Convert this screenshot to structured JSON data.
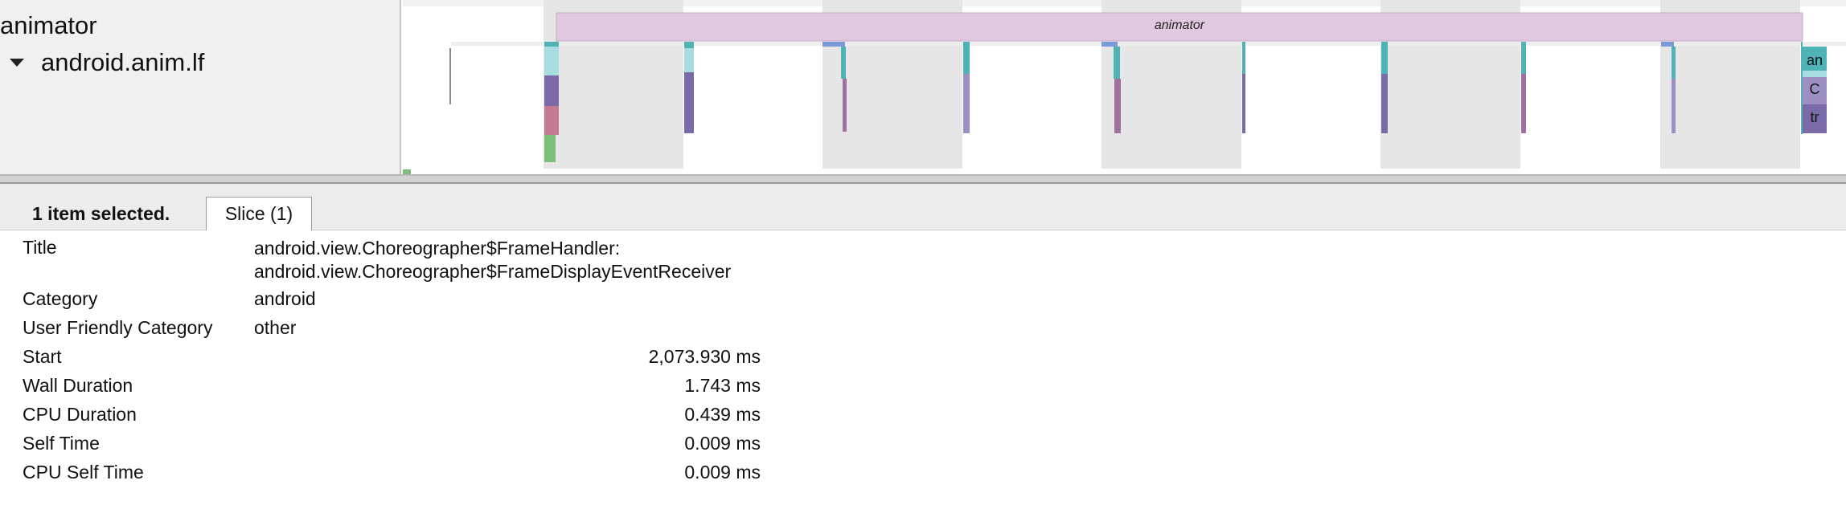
{
  "tracks": {
    "process_title": "animator",
    "thread_title": "android.anim.lf",
    "slice_top_label": "animator",
    "edge_labels": [
      "an",
      "C",
      "tr"
    ]
  },
  "colors": {
    "animator_slice": "#e0c8e0",
    "animator_slice_border": "#c8a8c8",
    "selected_column": "#e6e6e6",
    "teal": "#4fb3b5",
    "light_teal": "#a7dce0",
    "purple": "#7a6aa8",
    "light_purple": "#9d8fc4",
    "red": "#c47a90",
    "green": "#7bbf7b",
    "blue": "#7a9bd8"
  },
  "analysis": {
    "selection_summary": "1 item selected.",
    "tab_label": "Slice (1)",
    "details": [
      {
        "label": "Title",
        "value_lines": [
          "android.view.Choreographer$FrameHandler:",
          "android.view.Choreographer$FrameDisplayEventReceiver"
        ]
      },
      {
        "label": "Category",
        "value": "android"
      },
      {
        "label": "User Friendly Category",
        "value": "other"
      },
      {
        "label": "Start",
        "value": "2,073.930 ms"
      },
      {
        "label": "Wall Duration",
        "value": "1.743 ms"
      },
      {
        "label": "CPU Duration",
        "value": "0.439 ms"
      },
      {
        "label": "Self Time",
        "value": "0.009 ms"
      },
      {
        "label": "CPU Self Time",
        "value": "0.009 ms"
      }
    ]
  }
}
